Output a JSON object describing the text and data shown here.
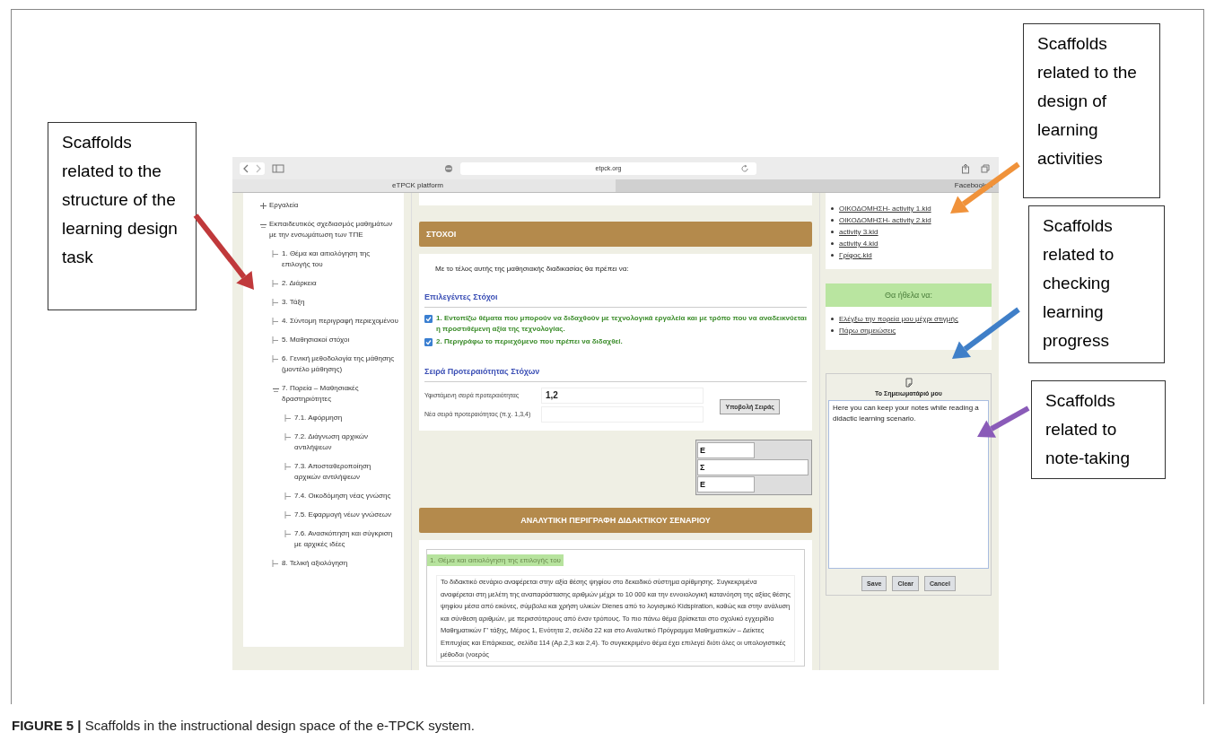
{
  "callouts": [
    {
      "text": "Scaffolds related to the structure of the learning design task",
      "color": "#c0393b"
    },
    {
      "text": "Scaffolds related to the design of learning activities",
      "color": "#f0923a"
    },
    {
      "text": "Scaffolds related to checking learning progress",
      "color": "#3f7fc8"
    },
    {
      "text": "Scaffolds related to note-taking",
      "color": "#8a5bb8"
    }
  ],
  "browser": {
    "url": "etpck.org",
    "tabs": [
      {
        "label": "eTPCK platform",
        "selected": true
      },
      {
        "label": "Facebook",
        "selected": false
      }
    ]
  },
  "sidebar": {
    "tree": [
      {
        "label": "Εργαλεία",
        "expanded": false
      },
      {
        "label": "Εκπαιδευτικός σχεδιασμός μαθημάτων με την ενσωμάτωση των ΤΠΕ",
        "expanded": true,
        "children": [
          {
            "label": "1. Θέμα και αιτιολόγηση της επιλογής του"
          },
          {
            "label": "2. Διάρκεια"
          },
          {
            "label": "3. Τάξη"
          },
          {
            "label": "4. Σύντομη περιγραφή περιεχομένου"
          },
          {
            "label": "5. Μαθησιακοί στόχοι"
          },
          {
            "label": "6. Γενική μεθοδολογία της μάθησης (μοντέλο μάθησης)"
          },
          {
            "label": "7. Πορεία – Μαθησιακές δραστηριότητες",
            "expanded": true,
            "children": [
              {
                "label": "7.1. Αφόρμηση"
              },
              {
                "label": "7.2. Διάγνωση αρχικών αντιλήψεων"
              },
              {
                "label": "7.3. Αποσταθεροποίηση αρχικών αντιλήψεων"
              },
              {
                "label": "7.4. Οικοδόμηση νέας γνώσης"
              },
              {
                "label": "7.5. Εφαρμογή νέων γνώσεων"
              },
              {
                "label": "7.6. Ανασκόπηση και σύγκριση με αρχικές ιδέες"
              }
            ]
          },
          {
            "label": "8. Τελική αξιολόγηση"
          }
        ]
      }
    ]
  },
  "main": {
    "goals_header": "ΣΤΟΧΟΙ",
    "intro": "Με το τέλος αυτής της μαθησιακής διαδικασίας θα πρέπει να:",
    "selected_goals_title": "Επιλεγέντες Στόχοι",
    "goals": [
      {
        "text": "1. Εντοπίζω θέματα που μπορούν να διδαχθούν με τεχνολογικά εργαλεία και με τρόπο που να αναδεικνύεται η προστιθέμενη αξία της τεχνολογίας.",
        "checked": true
      },
      {
        "text": "2. Περιγράφω το περιεχόμενο που πρέπει να διδαχθεί.",
        "checked": true
      }
    ],
    "priority_title": "Σειρά Προτεραιότητας Στόχων",
    "priority_form": {
      "current_label": "Υφιστάμενη σειρά προτεραιότητας",
      "current_value": "1,2",
      "new_label": "Νέα σειρά προτεραιότητας (π.χ. 1,3,4)",
      "submit": "Υποβολή Σειράς"
    },
    "popup_letters": [
      "Ε",
      "Σ",
      "Ε"
    ],
    "description_header": "ΑΝΑΛΥΤΙΚΗ ΠΕΡΙΓΡΑΦΗ ΔΙΔΑΚΤΙΚΟΥ ΣΕΝΑΡΙΟΥ",
    "section_legend": "1. Θέμα και αιτιολόγηση της επιλογής του",
    "section_text": "Το διδακτικό σενάριο αναφέρεται  στην αξία θέσης ψηφίου στο δεκαδικό σύστημα αρίθμησης. Συγκεκριμένα αναφέρεται στη μελέτη της αναπαράστασης αριθμών μέχρι το 10 000 και την εννοιολογική κατανόηση της αξίας θέσης ψηφίου μέσα από εικόνες, σύμβολα και χρήση υλικών Dienes από το λογισμικό Kidspiration, καθώς και στην ανάλυση και σύνθεση αριθμών, με περισσότερους από έναν τρόπους. Το πιο πάνω θέμα βρίσκεται στο σχολικό εγχειρίδιο Μαθηματικών Γ' τάξης, Μέρος 1, Ενότητα 2, σελίδα 22 και στο Αναλυτικό Πρόγραμμα Μαθηματικών – Δείκτες Επιτυχίας και Επάρκειας, σελίδα 114 (Αρ.2,3 και 2,4). Το συγκεκριμένο θέμα έχει επιλεγεί διότι όλες οι υπολογιστικές μέθοδοι (νοερός"
  },
  "right": {
    "files": [
      "ΟΙΚΟΔΟΜΗΣΗ- activity 1.kid",
      "ΟΙΚΟΔΟΜΗΣΗ- activity 2.kid",
      "activity 3.kid",
      "activity 4.kid",
      "Γρίφος.kid"
    ],
    "wish_title": "Θα ήθελα να:",
    "wish_links": [
      "Ελέγξω την πορεία μου μέχρι στιγμής",
      "Πάρω σημειώσεις"
    ],
    "notepad": {
      "title": "Το Σημειωματάριό μου",
      "value": "Here you can keep your notes while reading a didactic learning scenario.",
      "buttons": [
        "Save",
        "Clear",
        "Cancel"
      ]
    }
  },
  "figure": {
    "caption_label": "FIGURE 5 |",
    "caption": "Scaffolds in the instructional design space of the e-TPCK system."
  }
}
